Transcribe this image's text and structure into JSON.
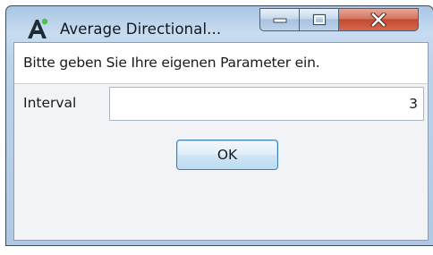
{
  "window": {
    "title": "Average Directional...",
    "controls": {
      "minimize_icon": "minimize-icon",
      "maximize_icon": "maximize-icon",
      "close_icon": "close-icon"
    },
    "app_icon": "app-logo-icon"
  },
  "dialog": {
    "prompt": "Bitte geben Sie Ihre eigenen Parameter ein.",
    "fields": [
      {
        "label": "Interval",
        "value": "3"
      }
    ],
    "ok_label": "OK"
  },
  "colors": {
    "title_bar": "#c7dcf0",
    "close_button": "#c24a30",
    "ok_border": "#3c7fb1",
    "client_bg": "#f1f3f7"
  }
}
